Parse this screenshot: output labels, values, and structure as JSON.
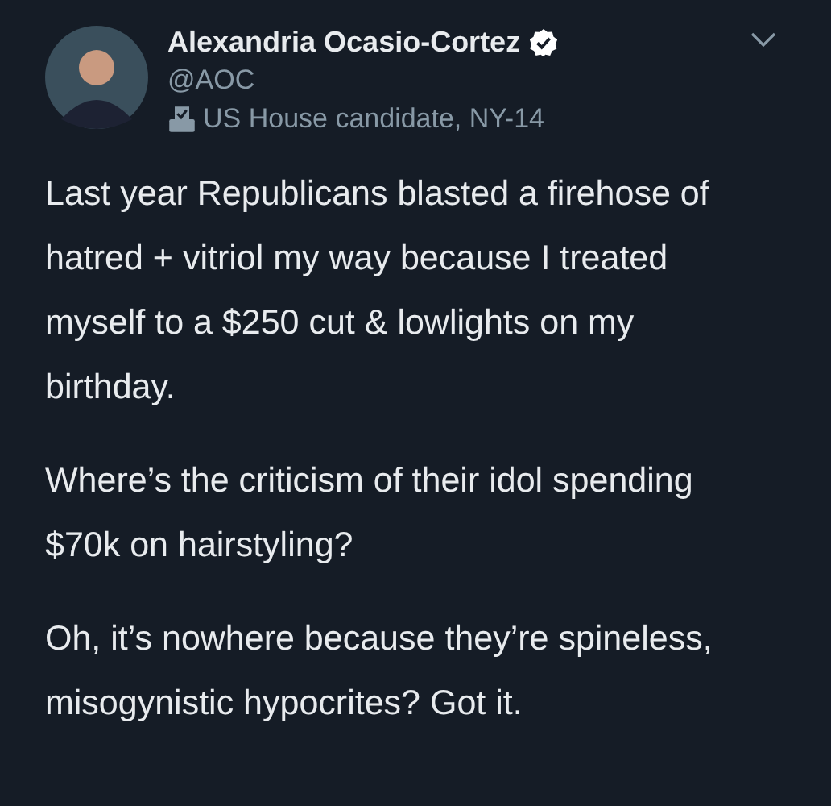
{
  "tweet": {
    "author": {
      "name": "Alexandria Ocasio-Cortez",
      "verified": true,
      "handle": "@AOC",
      "label": "US House candidate, NY-14"
    },
    "paragraphs": [
      "Last year Republicans blasted a firehose of hatred + vitriol my way because I treated myself to a $250 cut & lowlights on my birthday.",
      "Where’s the criticism of their idol spending $70k on hairstyling?",
      "Oh, it’s nowhere because they’re spineless, misogynistic hypocrites? Got it."
    ]
  }
}
